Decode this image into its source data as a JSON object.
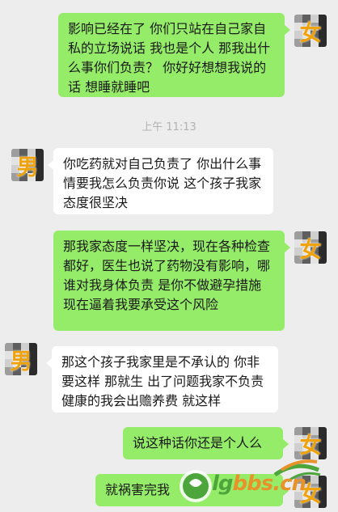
{
  "messages": [
    {
      "side": "out",
      "sender": "女",
      "text": "影响已经在了 你们只站在自己家自私的立场说话 我也是个人 那我出什么事你们负责？ 你好好想想我说的话 想睡就睡吧"
    },
    {
      "side": "in",
      "sender": "男",
      "text": "你吃药就对自己负责了 你出什么事情要我怎么负责你说 这个孩子我家态度很坚决"
    },
    {
      "side": "out",
      "sender": "女",
      "text": "那我家态度一样坚决，现在各种检查都好，医生也说了药物没有影响，哪谁对我身体负责 是你不做避孕措施 现在逼着我要承受这个风险"
    },
    {
      "side": "in",
      "sender": "男",
      "text": "那这个孩子我家里是不承认的 你非要这样 那就生 出了问题我家不负责 健康的我会出赡养费 就这样"
    },
    {
      "side": "out",
      "sender": "女",
      "text": "说这种话你还是个人么"
    },
    {
      "side": "out",
      "sender": "女",
      "text": "就祸害完我"
    }
  ],
  "timestamp": "上午 11:13",
  "watermark": {
    "brand_prefix": "lg",
    "brand_suffix": "bbs.cn"
  },
  "colors": {
    "outgoing_bubble": "#95ec69",
    "incoming_bubble": "#ffffff",
    "background": "#ededed",
    "avatar_label": "#f0a20a"
  }
}
